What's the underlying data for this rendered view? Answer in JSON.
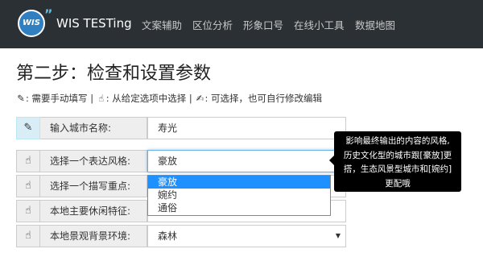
{
  "navbar": {
    "logo_text": "WIS",
    "brand": "WIS TESTing",
    "items": [
      "文案辅助",
      "区位分析",
      "形象口号",
      "在线小工具",
      "数据地图"
    ]
  },
  "page": {
    "title": "第二步：检查和设置参数",
    "legend": {
      "pencil_text": "需要手动填写",
      "hand_text": "从给定选项中选择",
      "edit_text": "可选择，也可自行修改编辑"
    }
  },
  "form": {
    "rows": [
      {
        "label": "输入城市名称:",
        "value": "寿光",
        "icon": "pencil-icon"
      },
      {
        "label": "选择一个表达风格:",
        "value": "豪放",
        "icon": "hand-pointer-icon"
      },
      {
        "label": "选择一个描写重点:",
        "value": "",
        "icon": "hand-pointer-icon"
      },
      {
        "label": "本地主要休闲特征:",
        "value": "",
        "icon": "hand-pointer-icon"
      },
      {
        "label": "本地景观背景环境:",
        "value": "森林",
        "icon": "hand-pointer-icon"
      }
    ],
    "style_options": [
      "豪放",
      "婉约",
      "通俗"
    ],
    "selected_option": "豪放"
  },
  "tooltip": {
    "lines": [
      "影响最终输出的内容的风格,",
      "历史文化型的城市跟[豪放]更",
      "搭，生态风景型城市和[婉约]",
      "更配哦"
    ]
  },
  "colors": {
    "navbar_bg": "#2b3034",
    "selected_option_bg": "#1e90ff",
    "focus_border": "#66afe9"
  }
}
